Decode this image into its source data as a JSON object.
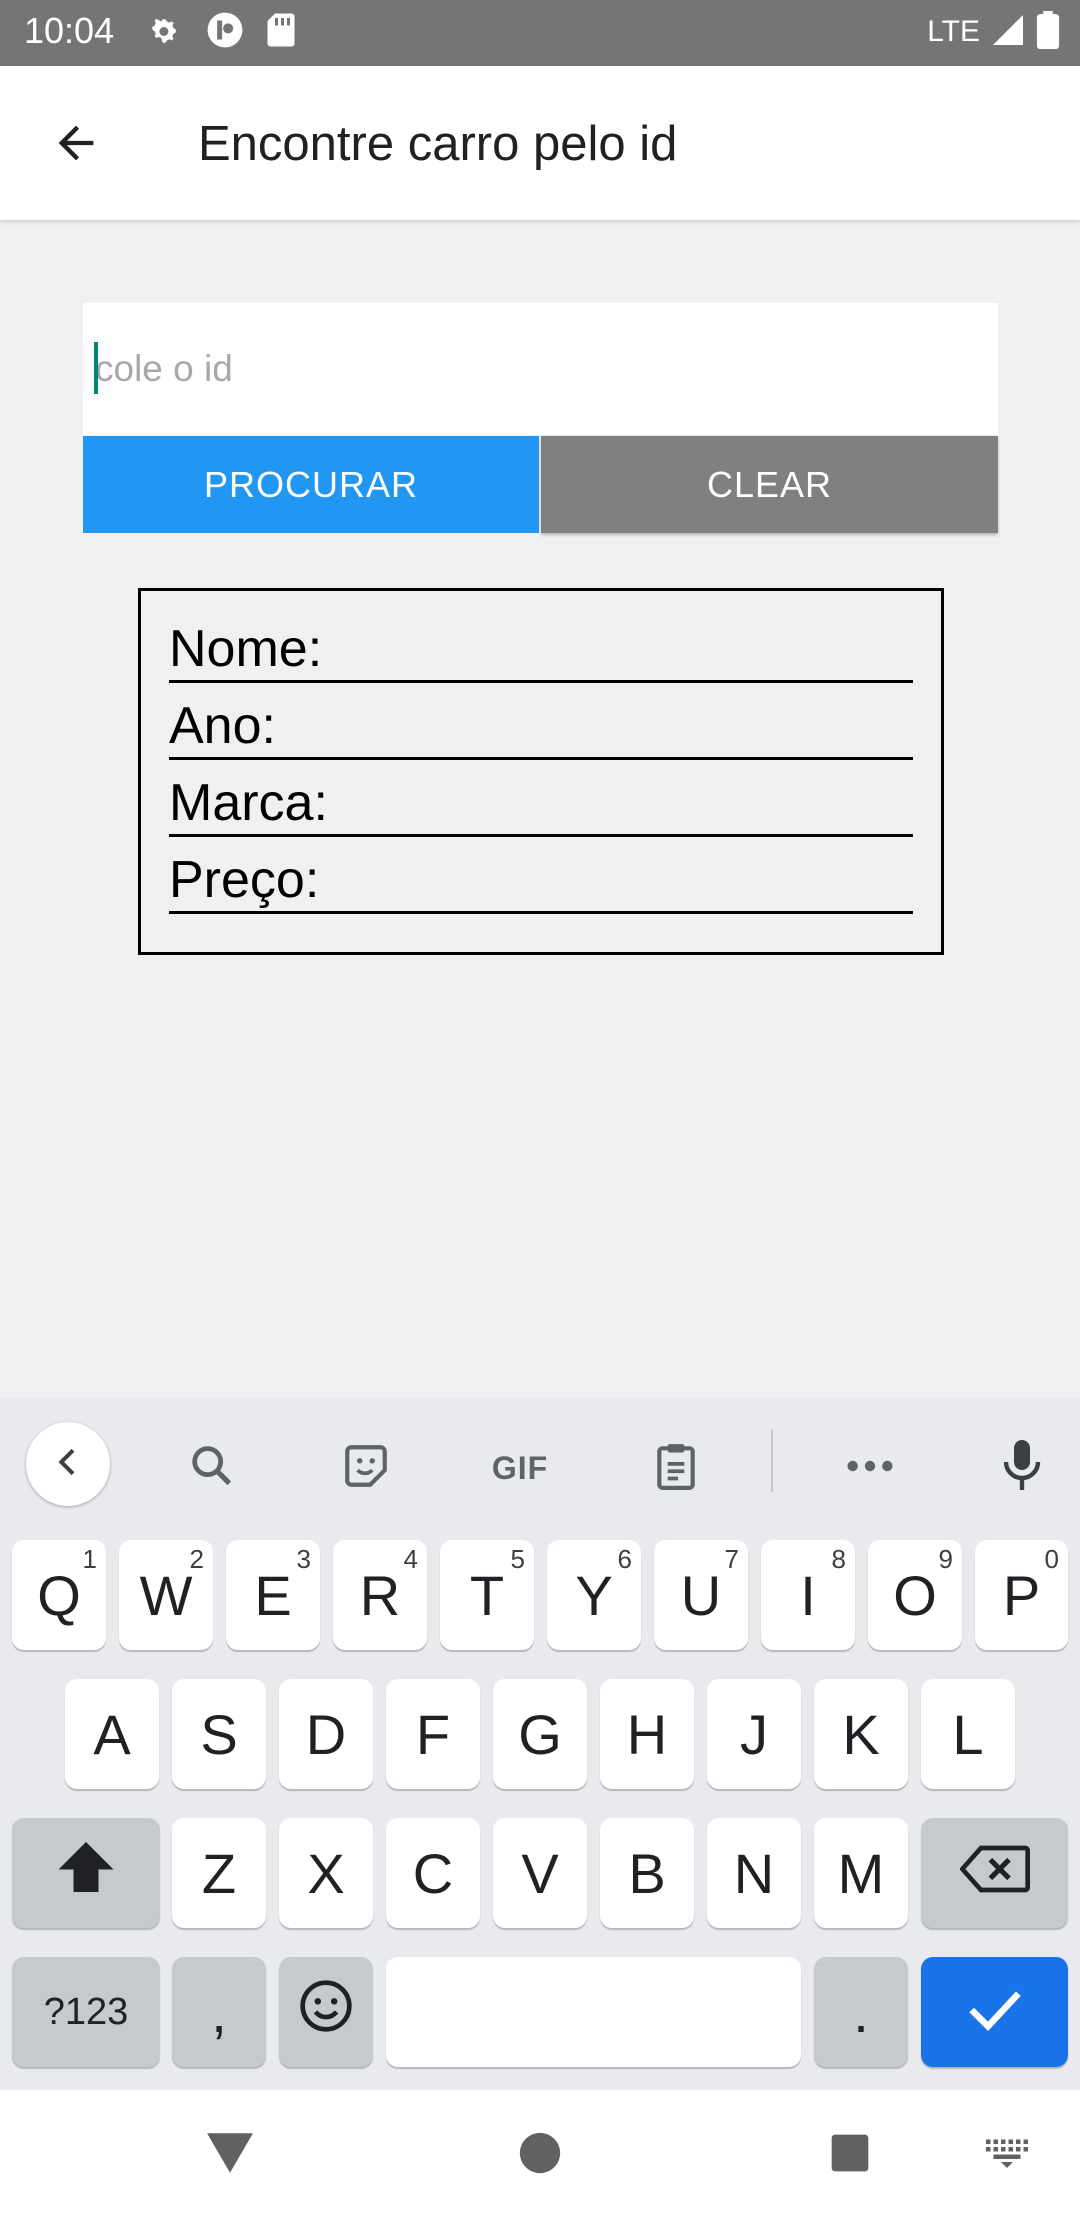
{
  "status_bar": {
    "time": "10:04",
    "network_label": "LTE",
    "icons": [
      "settings-icon",
      "notification-app-icon",
      "sd-card-icon",
      "signal-icon",
      "battery-icon"
    ]
  },
  "app_bar": {
    "title": "Encontre carro pelo id",
    "back_icon": "arrow-back-icon"
  },
  "search": {
    "placeholder": "cole o id",
    "value": "",
    "search_label": "PROCURAR",
    "clear_label": "CLEAR"
  },
  "result": {
    "fields": [
      {
        "label": "Nome:"
      },
      {
        "label": "Ano:"
      },
      {
        "label": "Marca:"
      },
      {
        "label": "Preço:"
      }
    ]
  },
  "keyboard": {
    "toolbar": [
      "chevron-left-icon",
      "search-icon",
      "sticker-icon",
      "GIF",
      "clipboard-icon",
      "more-icon",
      "mic-icon"
    ],
    "gif_label": "GIF",
    "row1": [
      {
        "key": "Q",
        "sup": "1"
      },
      {
        "key": "W",
        "sup": "2"
      },
      {
        "key": "E",
        "sup": "3"
      },
      {
        "key": "R",
        "sup": "4"
      },
      {
        "key": "T",
        "sup": "5"
      },
      {
        "key": "Y",
        "sup": "6"
      },
      {
        "key": "U",
        "sup": "7"
      },
      {
        "key": "I",
        "sup": "8"
      },
      {
        "key": "O",
        "sup": "9"
      },
      {
        "key": "P",
        "sup": "0"
      }
    ],
    "row2": [
      "A",
      "S",
      "D",
      "F",
      "G",
      "H",
      "J",
      "K",
      "L"
    ],
    "row3": [
      "Z",
      "X",
      "C",
      "V",
      "B",
      "N",
      "M"
    ],
    "symbols_label": "?123",
    "comma_label": ",",
    "period_label": ".",
    "shift_icon": "shift-icon",
    "backspace_icon": "backspace-icon",
    "emoji_icon": "emoji-icon",
    "enter_icon": "checkmark-icon",
    "colors": {
      "background": "#e8eaed",
      "key": "#ffffff",
      "special_key": "#c6c9ce",
      "enter": "#1a73e8"
    }
  },
  "nav_bar": {
    "icons": [
      "back-triangle-icon",
      "home-circle-icon",
      "recents-square-icon",
      "keyboard-switch-icon"
    ]
  },
  "colors": {
    "status_bar": "#757575",
    "primary_button": "#2196f3",
    "secondary_button": "#808080",
    "caret": "#008577"
  }
}
